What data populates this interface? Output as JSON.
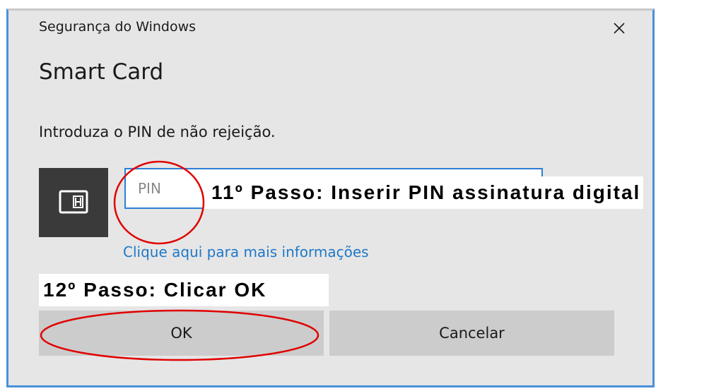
{
  "window": {
    "title": "Segurança do Windows",
    "heading": "Smart Card",
    "instruction": "Introduza o PIN de não rejeição.",
    "close_icon": "close-icon"
  },
  "pin": {
    "placeholder": "PIN",
    "value": "",
    "icon": "smart-card-icon"
  },
  "link": {
    "label": "Clique aqui para mais informações"
  },
  "buttons": {
    "ok_label": "OK",
    "cancel_label": "Cancelar"
  },
  "annotations": {
    "step11": "11º Passo:  Inserir PIN assinatura digital",
    "step12": "12º Passo:  Clicar OK",
    "highlight_color": "#e00000"
  },
  "colors": {
    "dialog_background": "#e6e6e6",
    "accent": "#2c7fd6",
    "link": "#1f78c8",
    "button": "#cccccc",
    "icon_tile": "#3a3a3a"
  }
}
